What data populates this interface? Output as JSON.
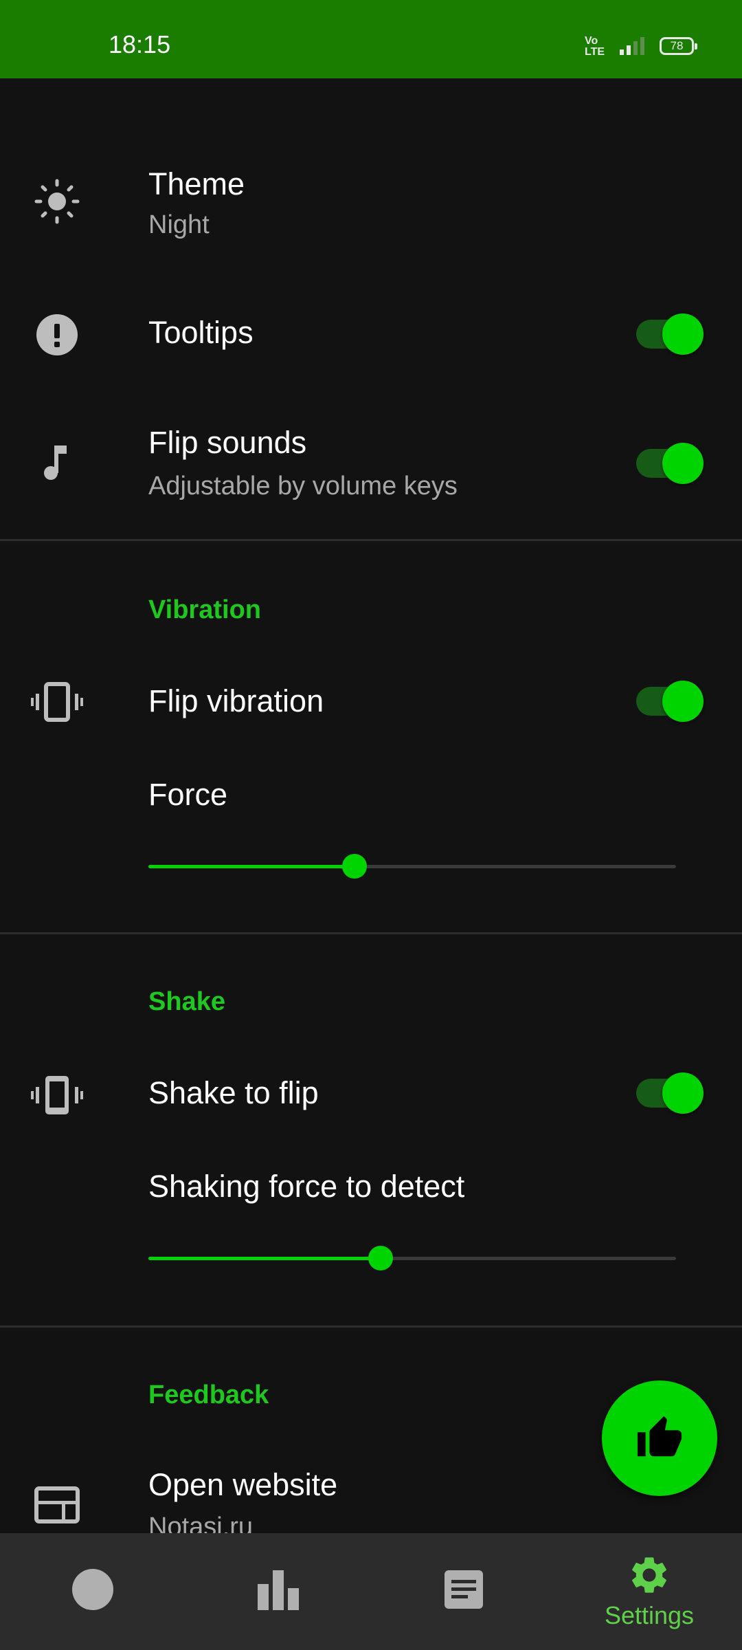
{
  "status_bar": {
    "time": "18:15",
    "network": "Vo LTE",
    "battery": "78"
  },
  "settings": {
    "theme": {
      "title": "Theme",
      "value": "Night",
      "icon": "sun-icon"
    },
    "tooltips": {
      "title": "Tooltips",
      "enabled": true,
      "icon": "exclamation-icon"
    },
    "flip_sounds": {
      "title": "Flip sounds",
      "subtitle": "Adjustable by volume keys",
      "enabled": true,
      "icon": "music-note-icon"
    }
  },
  "vibration": {
    "header": "Vibration",
    "flip_vibration": {
      "title": "Flip vibration",
      "enabled": true,
      "icon": "vibration-icon"
    },
    "force": {
      "title": "Force",
      "value_fraction": 0.39
    }
  },
  "shake": {
    "header": "Shake",
    "shake_to_flip": {
      "title": "Shake to flip",
      "enabled": true,
      "icon": "shake-phone-icon"
    },
    "shaking_force": {
      "title": "Shaking force to detect",
      "value_fraction": 0.44
    }
  },
  "feedback": {
    "header": "Feedback",
    "open_website": {
      "title": "Open website",
      "subtitle": "Notasi.ru",
      "icon": "web-icon"
    }
  },
  "fab": {
    "icon": "thumbs-up-icon"
  },
  "bottom_nav": {
    "items": [
      {
        "icon": "circle-icon",
        "label": ""
      },
      {
        "icon": "bar-chart-icon",
        "label": ""
      },
      {
        "icon": "notes-icon",
        "label": ""
      },
      {
        "icon": "gear-icon",
        "label": "Settings",
        "active": true
      }
    ]
  },
  "colors": {
    "status_bar": "#1b7d00",
    "background": "#121212",
    "accent": "#00d400",
    "section_header": "#1ec81e",
    "nav_bar": "#2c2c2c"
  }
}
